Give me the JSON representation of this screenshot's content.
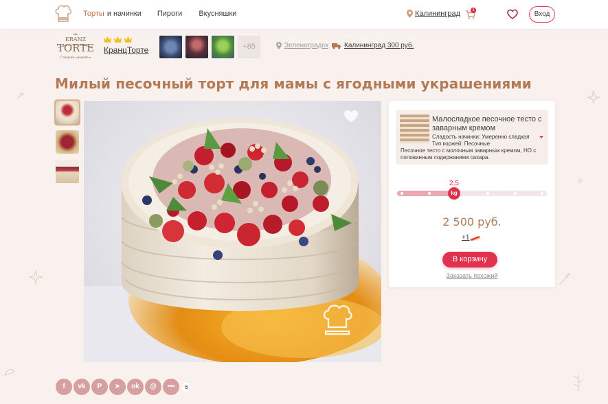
{
  "header": {
    "nav": {
      "cakes_accent": "Торты",
      "cakes_rest": "и начинки",
      "pies": "Пироги",
      "snacks": "Вкусняшки"
    },
    "city": "Калининград",
    "cart_count": "1",
    "login": "Вход"
  },
  "shop": {
    "logo_text_top": "KRANZ",
    "logo_text_main": "TORTE",
    "logo_text_sub": "Сладкие шедевры",
    "name": "КранцТорте",
    "crowns": 3,
    "more_photos": "+85",
    "location": "Зеленоградск",
    "delivery": "Калининград 300 руб."
  },
  "product": {
    "title": "Милый песочный торт для мамы с ягодными украшениями"
  },
  "order": {
    "filling": {
      "name": "Малосладкое песочное тесто с заварным кремом",
      "sweetness": "Сладость начинки: Умеренно сладкая",
      "layer_type": "Тип коржей: Песочные",
      "description": "Песочное тесто с молочным заварным кремом, НО с половинным содержанием сахара."
    },
    "weight": {
      "value": "2,5",
      "unit": "kg",
      "fraction": 0.38
    },
    "price": "2 500 руб.",
    "bonus": "+1",
    "add_to_cart": "В корзину",
    "order_similar": "Заказать похожий"
  },
  "social": {
    "share_count": "6"
  },
  "colors": {
    "accent": "#e0324f",
    "title": "#b47a56",
    "background": "#f8f1ee"
  }
}
